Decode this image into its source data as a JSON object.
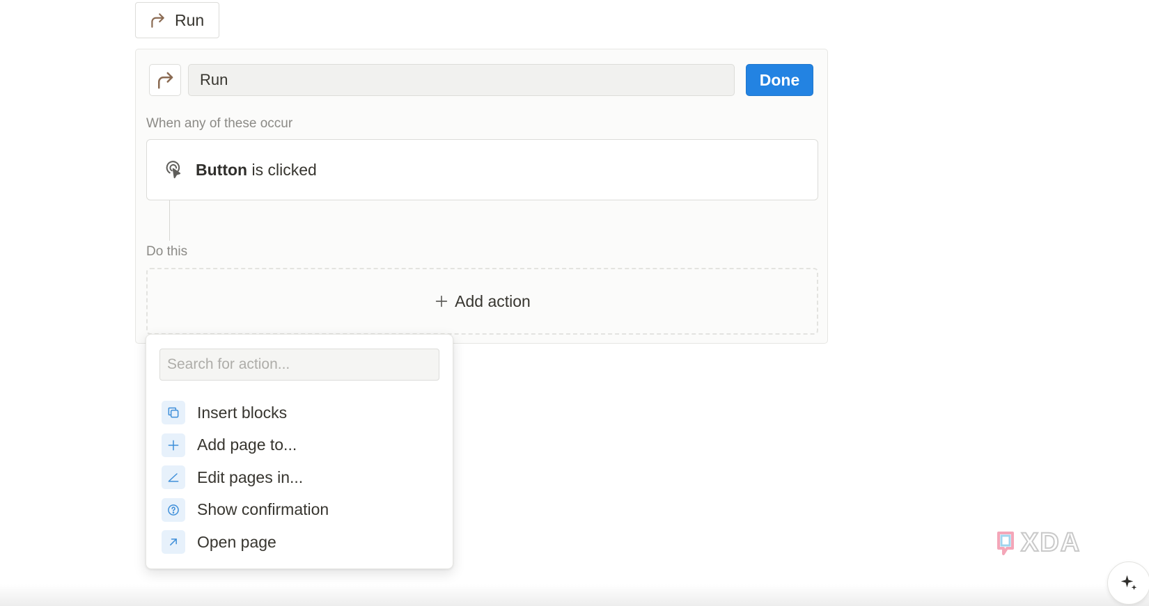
{
  "top_button": {
    "label": "Run",
    "icon": "turn-right-arrow-icon"
  },
  "editor": {
    "icon": "turn-right-arrow-icon",
    "name_value": "Run",
    "done_label": "Done",
    "trigger_section_label": "When any of these occur",
    "trigger": {
      "icon": "click-cursor-icon",
      "subject": "Button",
      "predicate": " is clicked"
    },
    "action_section_label": "Do this",
    "add_action_label": "Add action"
  },
  "action_menu": {
    "search_placeholder": "Search for action...",
    "items": [
      {
        "label": "Insert blocks",
        "icon": "copy-blocks-icon"
      },
      {
        "label": "Add page to...",
        "icon": "plus-icon"
      },
      {
        "label": "Edit pages in...",
        "icon": "edit-angle-icon"
      },
      {
        "label": "Show confirmation",
        "icon": "question-circle-icon"
      },
      {
        "label": "Open page",
        "icon": "arrow-up-right-icon"
      }
    ]
  },
  "watermark": {
    "text": "XDA"
  },
  "colors": {
    "accent_blue": "#2383e2",
    "arrow_brown": "#8a6a52",
    "menu_icon_bg": "#e7f1fb",
    "menu_icon_fg": "#3f8fd9"
  }
}
